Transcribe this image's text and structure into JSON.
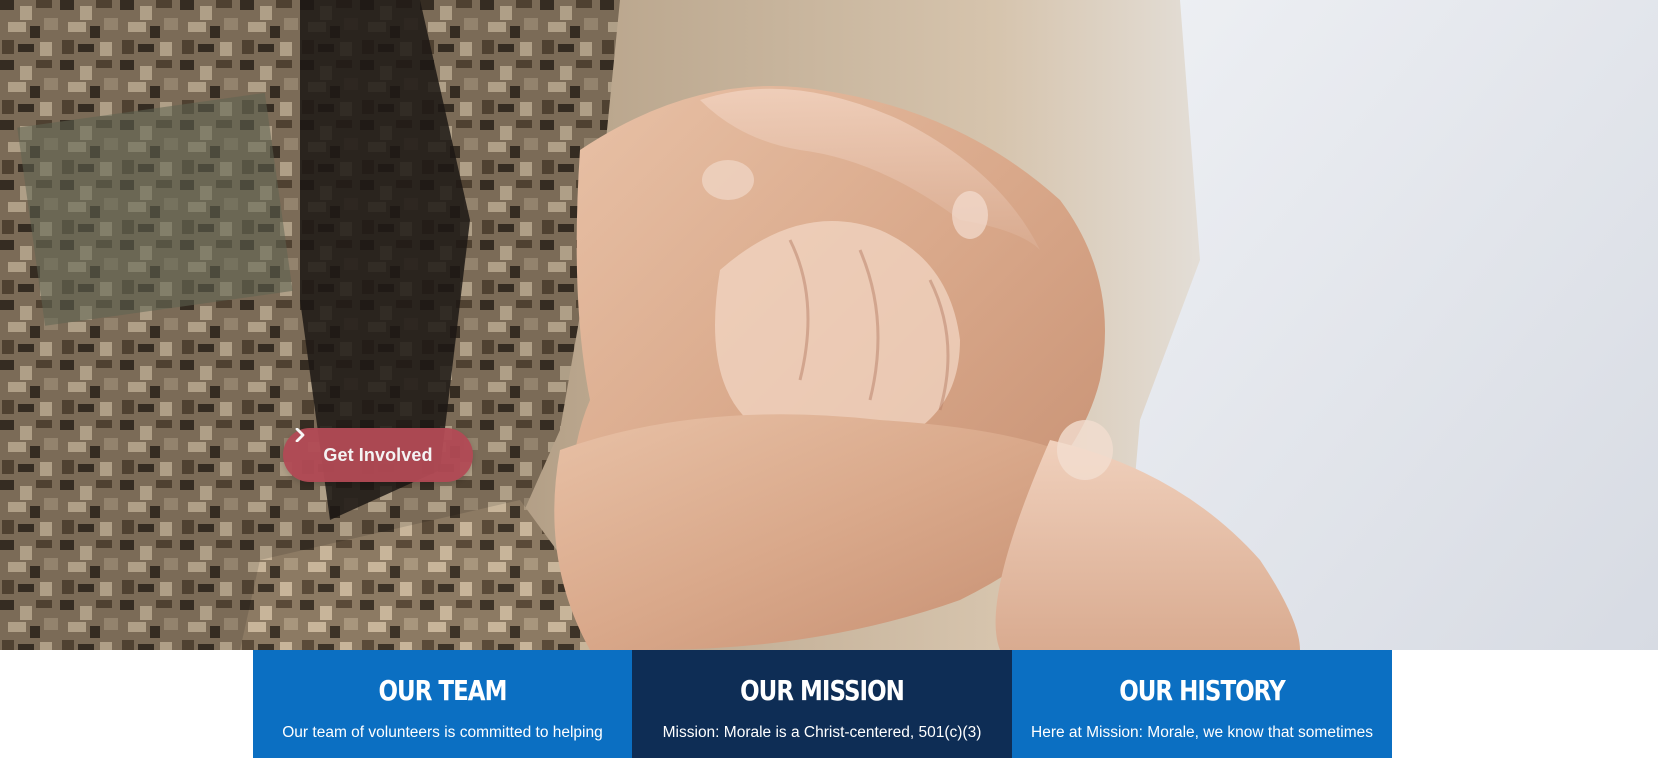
{
  "hero": {
    "image_description_icon": "hands-holding-photo",
    "cta": {
      "label": "Get Involved",
      "icon": "chevron-right-icon",
      "color": "#b24a55"
    }
  },
  "cards": [
    {
      "title": "OUR TEAM",
      "text": "Our team of volunteers is committed to helping",
      "color": "#0b6fc2"
    },
    {
      "title": "OUR MISSION",
      "text": "Mission: Morale is a Christ-centered, 501(c)(3)",
      "color": "#0e2d55"
    },
    {
      "title": "OUR HISTORY",
      "text": "Here at Mission: Morale, we know that sometimes",
      "color": "#0b6fc2"
    }
  ]
}
